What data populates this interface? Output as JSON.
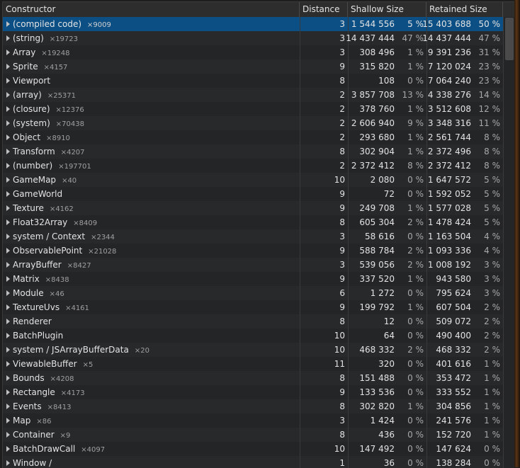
{
  "columns": {
    "constructor": "Constructor",
    "distance": "Distance",
    "shallow": "Shallow Size",
    "retained": "Retained Size"
  },
  "rows": [
    {
      "name": "(compiled code)",
      "count": "×9009",
      "distance": "3",
      "shallow": "1 544 556",
      "shallow_pct": "5 %",
      "retained": "15 403 688",
      "retained_pct": "50 %"
    },
    {
      "name": "(string)",
      "count": "×19723",
      "distance": "3",
      "shallow": "14 437 444",
      "shallow_pct": "47 %",
      "retained": "14 437 444",
      "retained_pct": "47 %"
    },
    {
      "name": "Array",
      "count": "×19248",
      "distance": "3",
      "shallow": "308 496",
      "shallow_pct": "1 %",
      "retained": "9 391 236",
      "retained_pct": "31 %"
    },
    {
      "name": "Sprite",
      "count": "×4157",
      "distance": "9",
      "shallow": "315 820",
      "shallow_pct": "1 %",
      "retained": "7 120 024",
      "retained_pct": "23 %"
    },
    {
      "name": "Viewport",
      "count": "",
      "distance": "8",
      "shallow": "108",
      "shallow_pct": "0 %",
      "retained": "7 064 240",
      "retained_pct": "23 %"
    },
    {
      "name": "(array)",
      "count": "×25371",
      "distance": "2",
      "shallow": "3 857 708",
      "shallow_pct": "13 %",
      "retained": "4 338 276",
      "retained_pct": "14 %"
    },
    {
      "name": "(closure)",
      "count": "×12376",
      "distance": "2",
      "shallow": "378 760",
      "shallow_pct": "1 %",
      "retained": "3 512 608",
      "retained_pct": "12 %"
    },
    {
      "name": "(system)",
      "count": "×70438",
      "distance": "2",
      "shallow": "2 606 940",
      "shallow_pct": "9 %",
      "retained": "3 348 316",
      "retained_pct": "11 %"
    },
    {
      "name": "Object",
      "count": "×8910",
      "distance": "2",
      "shallow": "293 680",
      "shallow_pct": "1 %",
      "retained": "2 561 744",
      "retained_pct": "8 %"
    },
    {
      "name": "Transform",
      "count": "×4207",
      "distance": "8",
      "shallow": "302 904",
      "shallow_pct": "1 %",
      "retained": "2 372 496",
      "retained_pct": "8 %"
    },
    {
      "name": "(number)",
      "count": "×197701",
      "distance": "2",
      "shallow": "2 372 412",
      "shallow_pct": "8 %",
      "retained": "2 372 412",
      "retained_pct": "8 %"
    },
    {
      "name": "GameMap",
      "count": "×40",
      "distance": "10",
      "shallow": "2 080",
      "shallow_pct": "0 %",
      "retained": "1 647 572",
      "retained_pct": "5 %"
    },
    {
      "name": "GameWorld",
      "count": "",
      "distance": "9",
      "shallow": "72",
      "shallow_pct": "0 %",
      "retained": "1 592 052",
      "retained_pct": "5 %"
    },
    {
      "name": "Texture",
      "count": "×4162",
      "distance": "9",
      "shallow": "249 708",
      "shallow_pct": "1 %",
      "retained": "1 577 028",
      "retained_pct": "5 %"
    },
    {
      "name": "Float32Array",
      "count": "×8409",
      "distance": "8",
      "shallow": "605 304",
      "shallow_pct": "2 %",
      "retained": "1 478 424",
      "retained_pct": "5 %"
    },
    {
      "name": "system / Context",
      "count": "×2344",
      "distance": "3",
      "shallow": "58 616",
      "shallow_pct": "0 %",
      "retained": "1 163 504",
      "retained_pct": "4 %"
    },
    {
      "name": "ObservablePoint",
      "count": "×21028",
      "distance": "9",
      "shallow": "588 784",
      "shallow_pct": "2 %",
      "retained": "1 093 336",
      "retained_pct": "4 %"
    },
    {
      "name": "ArrayBuffer",
      "count": "×8427",
      "distance": "3",
      "shallow": "539 056",
      "shallow_pct": "2 %",
      "retained": "1 008 192",
      "retained_pct": "3 %"
    },
    {
      "name": "Matrix",
      "count": "×8438",
      "distance": "9",
      "shallow": "337 520",
      "shallow_pct": "1 %",
      "retained": "943 580",
      "retained_pct": "3 %"
    },
    {
      "name": "Module",
      "count": "×46",
      "distance": "6",
      "shallow": "1 272",
      "shallow_pct": "0 %",
      "retained": "795 624",
      "retained_pct": "3 %"
    },
    {
      "name": "TextureUvs",
      "count": "×4161",
      "distance": "9",
      "shallow": "199 792",
      "shallow_pct": "1 %",
      "retained": "607 504",
      "retained_pct": "2 %"
    },
    {
      "name": "Renderer",
      "count": "",
      "distance": "8",
      "shallow": "12",
      "shallow_pct": "0 %",
      "retained": "509 072",
      "retained_pct": "2 %"
    },
    {
      "name": "BatchPlugin",
      "count": "",
      "distance": "10",
      "shallow": "64",
      "shallow_pct": "0 %",
      "retained": "490 400",
      "retained_pct": "2 %"
    },
    {
      "name": "system / JSArrayBufferData",
      "count": "×20",
      "distance": "10",
      "shallow": "468 332",
      "shallow_pct": "2 %",
      "retained": "468 332",
      "retained_pct": "2 %"
    },
    {
      "name": "ViewableBuffer",
      "count": "×5",
      "distance": "11",
      "shallow": "320",
      "shallow_pct": "0 %",
      "retained": "401 616",
      "retained_pct": "1 %"
    },
    {
      "name": "Bounds",
      "count": "×4208",
      "distance": "8",
      "shallow": "151 488",
      "shallow_pct": "0 %",
      "retained": "353 472",
      "retained_pct": "1 %"
    },
    {
      "name": "Rectangle",
      "count": "×4173",
      "distance": "9",
      "shallow": "133 536",
      "shallow_pct": "0 %",
      "retained": "333 552",
      "retained_pct": "1 %"
    },
    {
      "name": "Events",
      "count": "×8413",
      "distance": "8",
      "shallow": "302 820",
      "shallow_pct": "1 %",
      "retained": "304 856",
      "retained_pct": "1 %"
    },
    {
      "name": "Map",
      "count": "×86",
      "distance": "3",
      "shallow": "1 424",
      "shallow_pct": "0 %",
      "retained": "241 576",
      "retained_pct": "1 %"
    },
    {
      "name": "Container",
      "count": "×9",
      "distance": "8",
      "shallow": "436",
      "shallow_pct": "0 %",
      "retained": "152 720",
      "retained_pct": "1 %"
    },
    {
      "name": "BatchDrawCall",
      "count": "×4097",
      "distance": "10",
      "shallow": "147 492",
      "shallow_pct": "0 %",
      "retained": "147 624",
      "retained_pct": "0 %"
    },
    {
      "name": "Window /",
      "count": "",
      "distance": "1",
      "shallow": "36",
      "shallow_pct": "0 %",
      "retained": "138 284",
      "retained_pct": "0 %"
    }
  ],
  "selected_index": 0,
  "colors": {
    "selected_row": "#0b4f84",
    "background": "#242526",
    "header": "#2d2d2e"
  }
}
